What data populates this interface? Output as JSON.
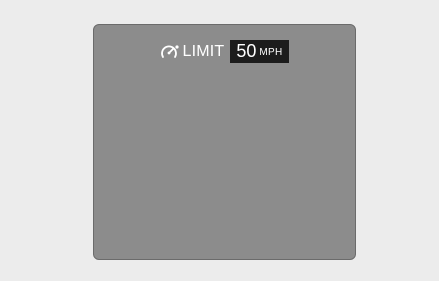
{
  "speed_limiter": {
    "icon": "speed-limiter-gauge-icon",
    "label": "LIMIT",
    "value": "50",
    "unit": "MPH"
  },
  "colors": {
    "background": "#ececec",
    "panel": "#8c8c8c",
    "value_box": "#1c1c1c",
    "text": "#ffffff"
  }
}
